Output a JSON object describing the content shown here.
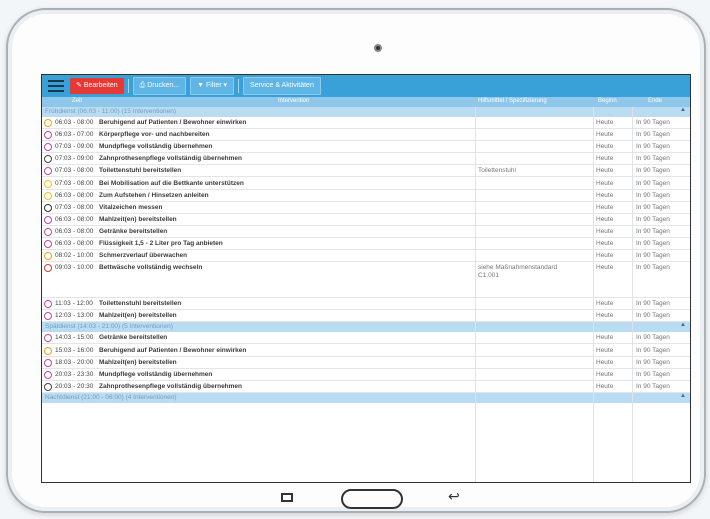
{
  "toolbar": {
    "edit_label": "Bearbeiten",
    "print_label": "Drucken...",
    "filter_label": "Filter",
    "services_label": "Service & Aktivitäten"
  },
  "columns": {
    "zeit": "Zeit",
    "intervention": "Intervention",
    "hilfsmittel": "Hilfsmittel / Spezifizierung",
    "beginn": "Beginn",
    "ende": "Ende"
  },
  "groups": [
    {
      "title": "Frühdienst (06:03 - 11:00) (15 Interventionen)",
      "rows": [
        {
          "zeit": "06:03 - 08:00",
          "intervention": "Beruhigend auf Patienten / Bewohner einwirken",
          "hilfsmittel": "",
          "beginn": "Heute",
          "ende": "In 90 Tagen",
          "color": "#f0a020"
        },
        {
          "zeit": "06:03 - 07:00",
          "intervention": "Körperpflege vor- und nachbereiten",
          "hilfsmittel": "",
          "beginn": "Heute",
          "ende": "In 90 Tagen",
          "color": "#c04aa0"
        },
        {
          "zeit": "07:03 - 09:00",
          "intervention": "Mundpflege vollständig übernehmen",
          "hilfsmittel": "",
          "beginn": "Heute",
          "ende": "In 90 Tagen",
          "color": "#c04aa0"
        },
        {
          "zeit": "07:03 - 09:00",
          "intervention": "Zahnprothesenpflege vollständig übernehmen",
          "hilfsmittel": "",
          "beginn": "Heute",
          "ende": "In 90 Tagen",
          "color": "#444444"
        },
        {
          "zeit": "07:03 - 08:00",
          "intervention": "Toilettenstuhl bereitstellen",
          "hilfsmittel": "Toilettenstuhl",
          "beginn": "Heute",
          "ende": "In 90 Tagen",
          "color": "#c04aa0"
        },
        {
          "zeit": "07:03 - 08:00",
          "intervention": "Bei Mobilisation auf die Bettkante unterstützen",
          "hilfsmittel": "",
          "beginn": "Heute",
          "ende": "In 90 Tagen",
          "color": "#f0c020"
        },
        {
          "zeit": "06:03 - 08:00",
          "intervention": "Zum Aufstehen / Hinsetzen anleiten",
          "hilfsmittel": "",
          "beginn": "Heute",
          "ende": "In 90 Tagen",
          "color": "#f0c020"
        },
        {
          "zeit": "07:03 - 08:00",
          "intervention": "Vitalzeichen messen",
          "hilfsmittel": "",
          "beginn": "Heute",
          "ende": "In 90 Tagen",
          "color": "#333333"
        },
        {
          "zeit": "06:03 - 08:00",
          "intervention": "Mahlzeit(en) bereitstellen",
          "hilfsmittel": "",
          "beginn": "Heute",
          "ende": "In 90 Tagen",
          "color": "#c04aa0"
        },
        {
          "zeit": "06:03 - 08:00",
          "intervention": "Getränke bereitstellen",
          "hilfsmittel": "",
          "beginn": "Heute",
          "ende": "In 90 Tagen",
          "color": "#c04aa0"
        },
        {
          "zeit": "06:03 - 08:00",
          "intervention": "Flüssigkeit 1,5 - 2 Liter pro Tag anbieten",
          "hilfsmittel": "",
          "beginn": "Heute",
          "ende": "In 90 Tagen",
          "color": "#c04aa0"
        },
        {
          "zeit": "08:02 - 10:00",
          "intervention": "Schmerzverlauf überwachen",
          "hilfsmittel": "",
          "beginn": "Heute",
          "ende": "In 90 Tagen",
          "color": "#f0a020"
        },
        {
          "zeit": "09:03 - 10:00",
          "intervention": "Bettwäsche vollständig wechseln",
          "hilfsmittel": "siehe Maßnahmenstandard C1.001",
          "beginn": "Heute",
          "ende": "In 90 Tagen",
          "color": "#e53935"
        },
        {
          "zeit": "11:03 - 12:00",
          "intervention": "Toilettenstuhl bereitstellen",
          "hilfsmittel": "",
          "beginn": "Heute",
          "ende": "In 90 Tagen",
          "color": "#c04aa0"
        },
        {
          "zeit": "12:03 - 13:00",
          "intervention": "Mahlzeit(en) bereitstellen",
          "hilfsmittel": "",
          "beginn": "Heute",
          "ende": "In 90 Tagen",
          "color": "#c04aa0"
        }
      ]
    },
    {
      "title": "Spätdienst (14:03 - 21:00) (5 Interventionen)",
      "rows": [
        {
          "zeit": "14:03 - 15:00",
          "intervention": "Getränke bereitstellen",
          "hilfsmittel": "",
          "beginn": "Heute",
          "ende": "In 90 Tagen",
          "color": "#c04aa0"
        },
        {
          "zeit": "15:03 - 16:00",
          "intervention": "Beruhigend auf Patienten / Bewohner einwirken",
          "hilfsmittel": "",
          "beginn": "Heute",
          "ende": "In 90 Tagen",
          "color": "#f0a020"
        },
        {
          "zeit": "18:03 - 20:00",
          "intervention": "Mahlzeit(en) bereitstellen",
          "hilfsmittel": "",
          "beginn": "Heute",
          "ende": "In 90 Tagen",
          "color": "#c04aa0"
        },
        {
          "zeit": "20:03 - 23:30",
          "intervention": "Mundpflege vollständig übernehmen",
          "hilfsmittel": "",
          "beginn": "Heute",
          "ende": "In 90 Tagen",
          "color": "#c04aa0"
        },
        {
          "zeit": "20:03 - 20:30",
          "intervention": "Zahnprothesenpflege vollständig übernehmen",
          "hilfsmittel": "",
          "beginn": "Heute",
          "ende": "In 90 Tagen",
          "color": "#444444"
        }
      ]
    },
    {
      "title": "Nachtdienst (21:00 - 06:00) (4 Interventionen)",
      "rows": []
    }
  ]
}
